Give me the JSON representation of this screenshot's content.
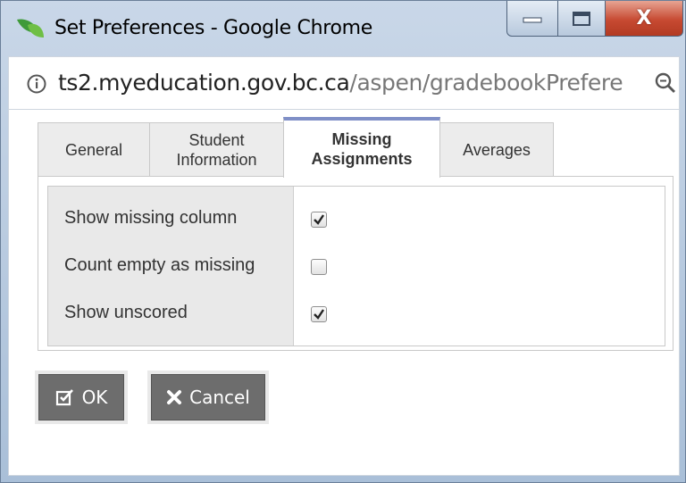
{
  "window": {
    "title": "Set Preferences - Google Chrome",
    "close_glyph": "X"
  },
  "address": {
    "host": "ts2.myeducation.gov.bc.ca",
    "path": "/aspen/gradebookPrefere"
  },
  "tabs": [
    {
      "label_line1": "General",
      "label_line2": "",
      "selected": false
    },
    {
      "label_line1": "Student",
      "label_line2": "Information",
      "selected": false
    },
    {
      "label_line1": "Missing",
      "label_line2": "Assignments",
      "selected": true
    },
    {
      "label_line1": "Averages",
      "label_line2": "",
      "selected": false
    }
  ],
  "options": [
    {
      "label": "Show missing column",
      "checked": true
    },
    {
      "label": "Count empty as missing",
      "checked": false
    },
    {
      "label": "Show unscored",
      "checked": true
    }
  ],
  "buttons": {
    "ok_label": "OK",
    "cancel_label": "Cancel"
  },
  "icons": {
    "app": "chrome-logo-icon",
    "info": "info-icon",
    "zoom": "zoom-icon",
    "ok": "checkbox-edit-icon",
    "cancel": "x-icon"
  },
  "colors": {
    "selected_tab_accent": "#7f8fc7",
    "button_bg": "#6d6d6d",
    "close_button": "#c74a32"
  }
}
